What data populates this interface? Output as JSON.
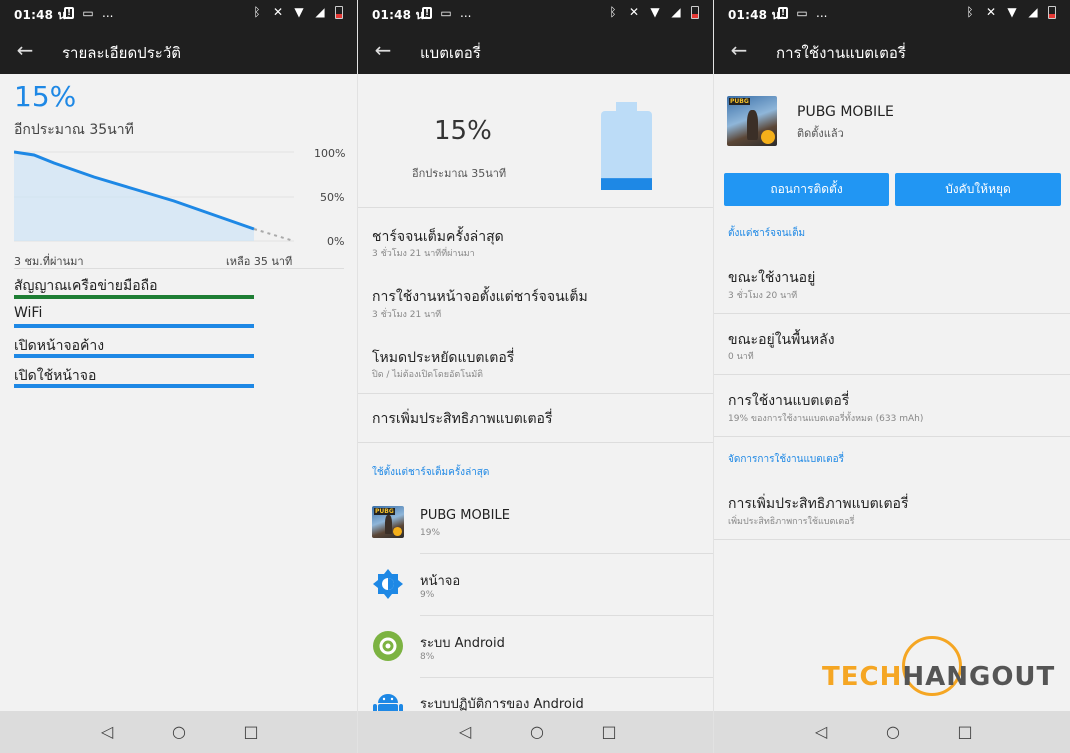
{
  "status": {
    "time": "01:48 น.",
    "more": "..."
  },
  "nav": {
    "back": "◁",
    "home": "○",
    "recents": "□"
  },
  "panel1": {
    "title": "รายละเอียดประวัติ",
    "percent": "15%",
    "remaining": "อีกประมาณ 35นาที",
    "y_ticks": [
      "100%",
      "50%",
      "0%"
    ],
    "x_start": "3 ชม.ที่ผ่านมา",
    "x_end": "เหลือ 35 นาที",
    "signals": [
      {
        "label": "สัญญาณเครือข่ายมือถือ",
        "color": "#1e7e34"
      },
      {
        "label": "WiFi",
        "color": "#1e88e5"
      },
      {
        "label": "เปิดหน้าจอค้าง",
        "color": "#1e88e5"
      },
      {
        "label": "เปิดใช้หน้าจอ",
        "color": "#1e88e5"
      }
    ]
  },
  "panel2": {
    "title": "แบตเตอรี่",
    "percent": "15%",
    "remaining": "อีกประมาณ 35นาที",
    "battery_level": 0.15,
    "items": [
      {
        "title": "ชาร์จจนเต็มครั้งล่าสุด",
        "sub": "3 ชั่วโมง 21 นาทีที่ผ่านมา"
      },
      {
        "title": "การใช้งานหน้าจอตั้งแต่ชาร์จจนเต็ม",
        "sub": "3 ชั่วโมง 21 นาที"
      },
      {
        "title": "โหมดประหยัดแบตเตอรี่",
        "sub": "ปิด / ไม่ต้องเปิดโดยอัตโนมัติ"
      },
      {
        "title": "การเพิ่มประสิทธิภาพแบตเตอรี่",
        "sub": ""
      }
    ],
    "section": "ใช้ตั้งแต่ชาร์จเต็มครั้งล่าสุด",
    "apps": [
      {
        "name": "PUBG MOBILE",
        "pct": "19%",
        "icon": "pubg-icon"
      },
      {
        "name": "หน้าจอ",
        "pct": "9%",
        "icon": "brightness-icon"
      },
      {
        "name": "ระบบ Android",
        "pct": "8%",
        "icon": "android-system-icon"
      },
      {
        "name": "ระบบปฏิบัติการของ Android",
        "pct": "",
        "icon": "android-icon"
      }
    ]
  },
  "panel3": {
    "title": "การใช้งานแบตเตอรี่",
    "app_name": "PUBG MOBILE",
    "app_status": "ติดตั้งแล้ว",
    "uninstall": "ถอนการติดตั้ง",
    "force_stop": "บังคับให้หยุด",
    "section1": "ตั้งแต่ชาร์จจนเต็ม",
    "items": [
      {
        "title": "ขณะใช้งานอยู่",
        "sub": "3 ชั่วโมง 20 นาที"
      },
      {
        "title": "ขณะอยู่ในพื้นหลัง",
        "sub": "0 นาที"
      },
      {
        "title": "การใช้งานแบตเตอรี่",
        "sub": "19% ของการใช้งานแบตเตอรี่ทั้งหมด (633 mAh)"
      }
    ],
    "section2": "จัดการการใช้งานแบตเตอรี่",
    "opt_title": "การเพิ่มประสิทธิภาพแบตเตอรี่",
    "opt_sub": "เพิ่มประสิทธิภาพการใช้แบตเตอรี่"
  },
  "logo": {
    "text_a": "TECH",
    "text_b": "HANGOUT"
  },
  "colors": {
    "accent": "#1e88e5",
    "button": "#2196f3",
    "dark_bar": "#1f1f1f",
    "network": "#1e7e34"
  }
}
